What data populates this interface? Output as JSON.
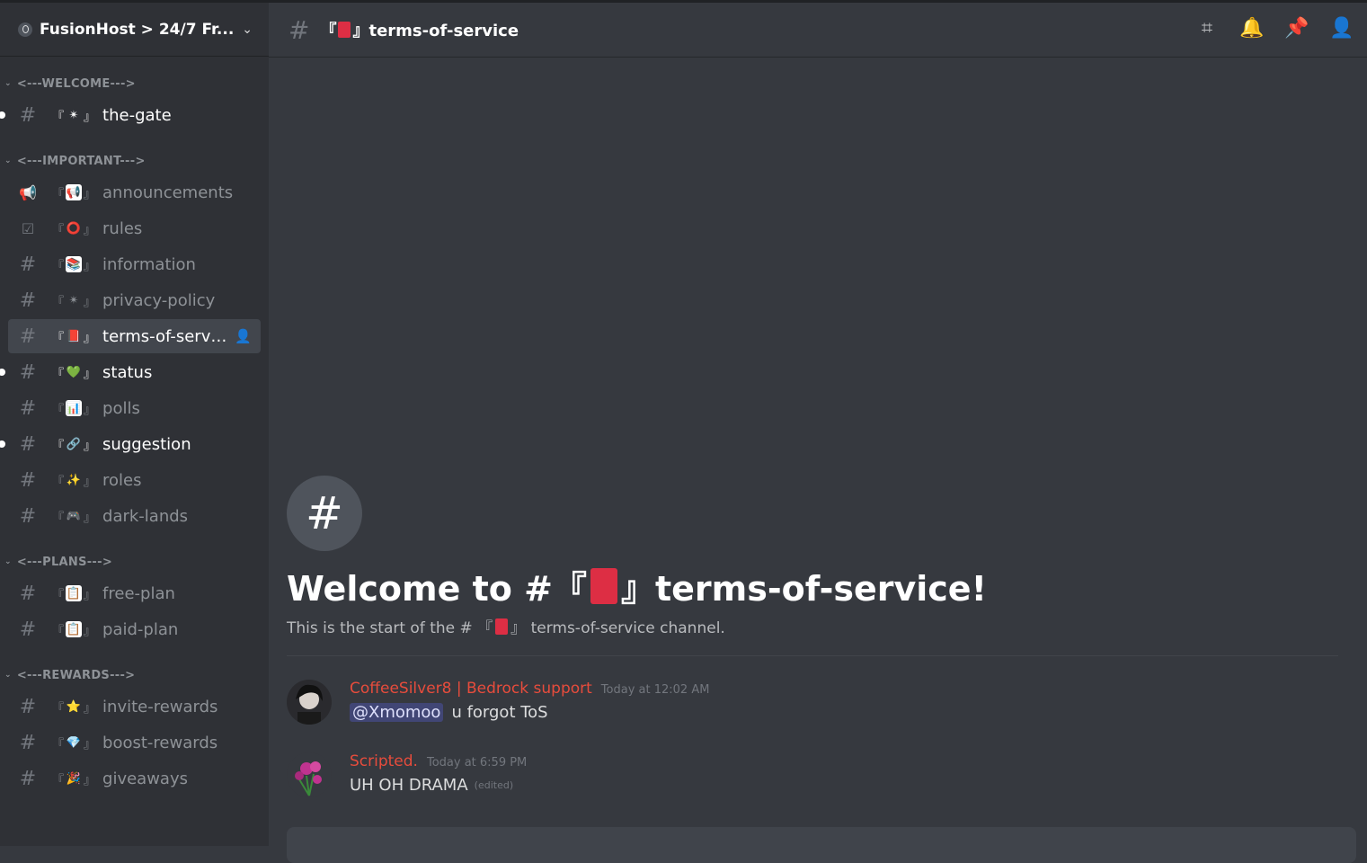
{
  "server": {
    "name": "FusionHost > 24/7 Fr..."
  },
  "categories": [
    {
      "label": "<---WELCOME--->",
      "channels": [
        {
          "icon": "hash-icon",
          "emoji": "✴",
          "emoji_bg": "",
          "name": "the-gate",
          "unread": true
        }
      ]
    },
    {
      "label": "<---IMPORTANT--->",
      "channels": [
        {
          "icon": "megaphone-icon",
          "emoji": "📢",
          "emoji_bg": "#ffffff",
          "name": "announcements",
          "unread": false
        },
        {
          "icon": "rules-icon",
          "emoji": "⭕",
          "emoji_bg": "",
          "name": "rules",
          "unread": false
        },
        {
          "icon": "hash-icon",
          "emoji": "📚",
          "emoji_bg": "#ffffff",
          "name": "information",
          "unread": false
        },
        {
          "icon": "hash-icon",
          "emoji": "✴",
          "emoji_bg": "",
          "name": "privacy-policy",
          "unread": false
        },
        {
          "icon": "hash-icon",
          "emoji": "📕",
          "emoji_bg": "",
          "name": "terms-of-servi...",
          "unread": false,
          "selected": true
        },
        {
          "icon": "hash-icon",
          "emoji": "💚",
          "emoji_bg": "",
          "name": "status",
          "unread": true
        },
        {
          "icon": "hash-icon",
          "emoji": "📊",
          "emoji_bg": "#ffffff",
          "name": "polls",
          "unread": false
        },
        {
          "icon": "hash-icon",
          "emoji": "🔗",
          "emoji_bg": "",
          "name": "suggestion",
          "unread": true
        },
        {
          "icon": "hash-icon",
          "emoji": "✨",
          "emoji_bg": "",
          "name": "roles",
          "unread": false
        },
        {
          "icon": "hash-icon",
          "emoji": "🎮",
          "emoji_bg": "",
          "name": "dark-lands",
          "unread": false
        }
      ]
    },
    {
      "label": "<---PLANS--->",
      "channels": [
        {
          "icon": "hash-icon",
          "emoji": "📋",
          "emoji_bg": "#ffffff",
          "name": "free-plan",
          "unread": false
        },
        {
          "icon": "hash-icon",
          "emoji": "📋",
          "emoji_bg": "#ffffff",
          "name": "paid-plan",
          "unread": false
        }
      ]
    },
    {
      "label": "<---REWARDS--->",
      "channels": [
        {
          "icon": "hash-icon",
          "emoji": "⭐",
          "emoji_bg": "",
          "name": "invite-rewards",
          "unread": false
        },
        {
          "icon": "hash-icon",
          "emoji": "💎",
          "emoji_bg": "",
          "name": "boost-rewards",
          "unread": false
        },
        {
          "icon": "hash-icon",
          "emoji": "🎉",
          "emoji_bg": "",
          "name": "giveaways",
          "unread": false
        }
      ]
    }
  ],
  "topbar": {
    "channel_prefix": "『",
    "channel_suffix": "』terms-of-service",
    "icons": [
      "threads-icon",
      "bell-icon",
      "pin-icon",
      "members-icon"
    ]
  },
  "welcome": {
    "title_prefix": "Welcome to #『",
    "title_suffix": "』terms-of-service!",
    "sub_prefix": "This is the start of the # 『",
    "sub_suffix": "』 terms-of-service channel."
  },
  "messages": [
    {
      "author": "CoffeeSilver8 | Bedrock support",
      "time": "Today at 12:02 AM",
      "mention": "@Xmomoo",
      "text": "u forgot ToS",
      "edited": ""
    },
    {
      "author": "Scripted.",
      "time": "Today at 6:59 PM",
      "mention": "",
      "text": "UH OH DRAMA",
      "edited": "(edited)"
    }
  ],
  "colors": {
    "author": "#e74c3c",
    "selected_bg": "#42464d",
    "sidebar_bg": "#2f3136",
    "chat_bg": "#36393f"
  }
}
